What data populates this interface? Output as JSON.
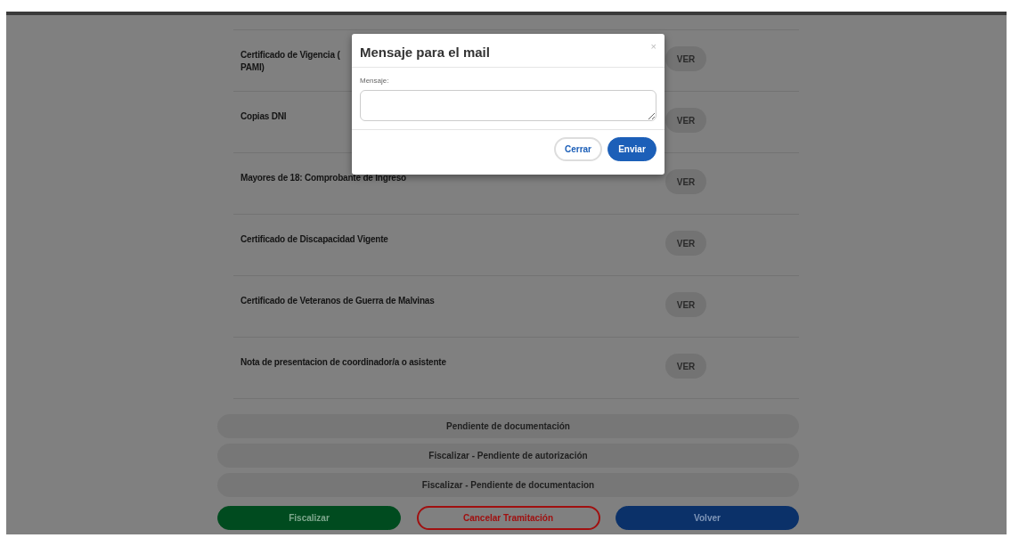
{
  "documents": [
    {
      "lines": [
        "Certificado de Vigencia (",
        "PAMI)"
      ],
      "action": "VER"
    },
    {
      "lines": [
        "Copias DNI"
      ],
      "action": "VER"
    },
    {
      "lines": [
        "Mayores de 18: Comprobante de Ingreso"
      ],
      "action": "VER"
    },
    {
      "lines": [
        "Certificado de Discapacidad Vigente"
      ],
      "action": "VER"
    },
    {
      "lines": [
        "Certificado de Veteranos de Guerra de Malvinas"
      ],
      "action": "VER"
    },
    {
      "lines": [
        "Nota de presentacion de coordinador/a o asistente"
      ],
      "action": "VER"
    }
  ],
  "status_buttons": [
    "Pendiente de documentación",
    "Fiscalizar - Pendiente de autorización",
    "Fiscalizar - Pendiente de documentacion"
  ],
  "actions": [
    {
      "label": "Fiscalizar",
      "kind": "success"
    },
    {
      "label": "Cancelar Tramitación",
      "kind": "danger"
    },
    {
      "label": "Volver",
      "kind": "primary"
    }
  ],
  "modal": {
    "title": "Mensaje para el mail",
    "close": "×",
    "field_label": "Mensaje:",
    "buttons": [
      {
        "label": "Cerrar",
        "kind": "secondary"
      },
      {
        "label": "Enviar",
        "kind": "primary"
      }
    ]
  }
}
